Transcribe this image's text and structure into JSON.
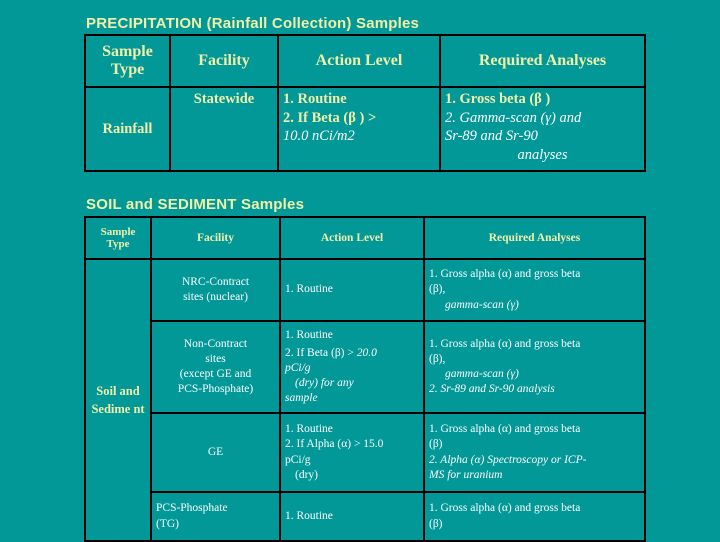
{
  "colors": {
    "background": "#039898",
    "border": "#000000",
    "heading_text": "#f0f0a8",
    "body_text": "#ffffff"
  },
  "precipitation": {
    "title": "PRECIPITATION (Rainfall Collection) Samples",
    "headers": {
      "sample_type": "Sample Type",
      "facility": "Facility",
      "action_level": "Action Level",
      "required_analyses": "Required Analyses"
    },
    "rows": [
      {
        "sample_type": "Rainfall",
        "facility": "Statewide",
        "action_level": {
          "line1": "1. Routine",
          "line2": "2. If Beta (β )  >",
          "line3": "10.0 nCi/m2"
        },
        "required_analyses": {
          "line1": "1. Gross beta (β )",
          "line2": "2. Gamma-scan (γ) and",
          "line3": "Sr-89 and Sr-90",
          "line4": "analyses"
        }
      }
    ]
  },
  "soil_sediment": {
    "title": "SOIL and SEDIMENT Samples",
    "headers": {
      "sample_type": "Sample Type",
      "facility": "Facility",
      "action_level": "Action Level",
      "required_analyses": "Required Analyses"
    },
    "sample_type_label": "Soil and Sedime nt",
    "rows": [
      {
        "facility": {
          "line1": "NRC-Contract",
          "line2": "sites (nuclear)"
        },
        "action_level": {
          "line1": "1. Routine"
        },
        "required_analyses": {
          "line1": "1. Gross alpha (α) and gross beta",
          "line2": "(β),",
          "line3": "gamma-scan (γ)"
        }
      },
      {
        "facility": {
          "line1": "Non-Contract",
          "line2": "sites",
          "line3": "(except GE and",
          "line4": "PCS-Phosphate)"
        },
        "action_level": {
          "line1": "1. Routine",
          "line2": "2. If Beta (β) > ",
          "line2_ital": "20.0",
          "line3": "pCi/g",
          "line4": "(dry) for any",
          "line5": "sample"
        },
        "required_analyses": {
          "line1": "1. Gross alpha (α) and gross beta",
          "line2": "(β),",
          "line3": "gamma-scan (γ)",
          "line4": "2. Sr-89 and Sr-90 analysis"
        }
      },
      {
        "facility": {
          "line1": "GE"
        },
        "action_level": {
          "line1": "1. Routine",
          "line2": "2. If Alpha (α) > 15.0",
          "line3": "pCi/g",
          "line4": "(dry)"
        },
        "required_analyses": {
          "line1": "1. Gross alpha (α) and gross beta",
          "line2": "(β)",
          "line3": "2. Alpha (α) Spectroscopy or ICP-",
          "line4": "MS for uranium"
        }
      },
      {
        "facility": {
          "line1": "PCS-Phosphate",
          "line2": "(TG)"
        },
        "action_level": {
          "line1": "1. Routine"
        },
        "required_analyses": {
          "line1": "1. Gross alpha (α) and gross beta",
          "line2": "(β)"
        }
      }
    ]
  }
}
